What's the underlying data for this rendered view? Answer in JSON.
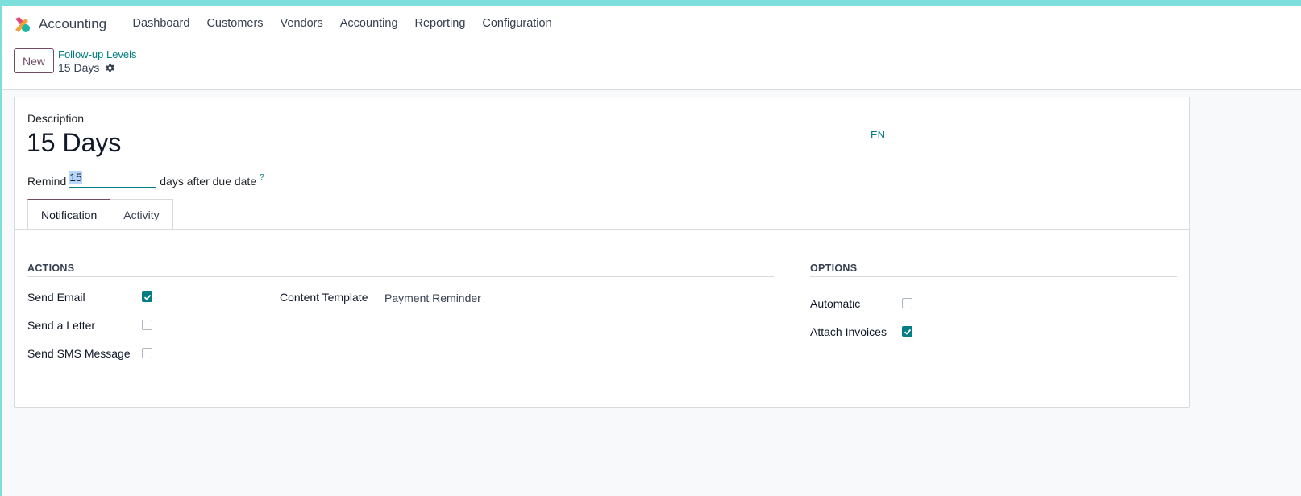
{
  "app": {
    "name": "Accounting",
    "menu": [
      "Dashboard",
      "Customers",
      "Vendors",
      "Accounting",
      "Reporting",
      "Configuration"
    ]
  },
  "control_panel": {
    "new_label": "New",
    "breadcrumb_parent": "Follow-up Levels",
    "breadcrumb_current": "15 Days"
  },
  "form": {
    "description_label": "Description",
    "title": "15 Days",
    "lang": "EN",
    "remind_prefix": "Remind",
    "remind_value": "15",
    "remind_suffix": "days after due date",
    "help": "?"
  },
  "tabs": [
    "Notification",
    "Activity"
  ],
  "actions": {
    "title": "ACTIONS",
    "send_email_label": "Send Email",
    "send_email_checked": true,
    "send_letter_label": "Send a Letter",
    "send_letter_checked": false,
    "send_sms_label": "Send SMS Message",
    "send_sms_checked": false,
    "content_template_label": "Content Template",
    "content_template_value": "Payment Reminder"
  },
  "options": {
    "title": "OPTIONS",
    "automatic_label": "Automatic",
    "automatic_checked": false,
    "attach_invoices_label": "Attach Invoices",
    "attach_invoices_checked": true
  },
  "colors": {
    "brand": "#714b67",
    "accent": "#017e84",
    "top_strip": "#7ddfdb"
  },
  "icons": {
    "app_logo": "accounting-logo",
    "gear": "gear-icon",
    "check": "check-icon"
  }
}
